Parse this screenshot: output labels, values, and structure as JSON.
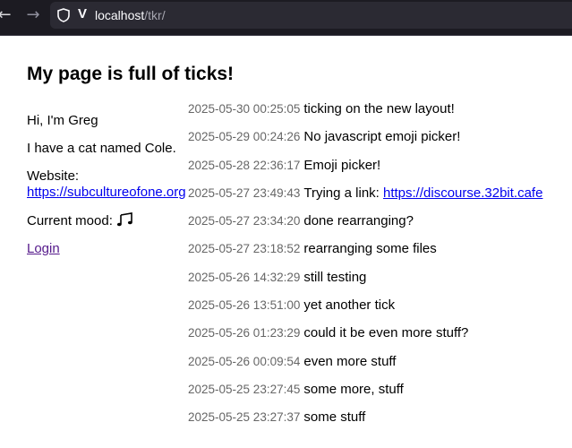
{
  "browser": {
    "url_host": "localhost",
    "url_path": "/tkr/",
    "back_icon": "arrow-left-icon",
    "forward_icon": "arrow-right-icon"
  },
  "page": {
    "title": "My page is full of ticks!"
  },
  "sidebar": {
    "greeting": "Hi, I'm Greg",
    "bio": "I have a cat named Cole.",
    "website_label": "Website:",
    "website_link": "https://subcultureofone.org",
    "mood_label": "Current mood: ",
    "mood_icon": "music-note-icon",
    "login_link": "Login"
  },
  "ticks": [
    {
      "timestamp": "2025-05-30 00:25:05",
      "text": "ticking on the new layout!"
    },
    {
      "timestamp": "2025-05-29 00:24:26",
      "text": "No javascript emoji picker!"
    },
    {
      "timestamp": "2025-05-28 22:36:17",
      "text": "Emoji picker!"
    },
    {
      "timestamp": "2025-05-27 23:49:43",
      "text": "Trying a link: ",
      "link": "https://discourse.32bit.cafe"
    },
    {
      "timestamp": "2025-05-27 23:34:20",
      "text": "done rearranging?"
    },
    {
      "timestamp": "2025-05-27 23:18:52",
      "text": "rearranging some files"
    },
    {
      "timestamp": "2025-05-26 14:32:29",
      "text": "still testing"
    },
    {
      "timestamp": "2025-05-26 13:51:00",
      "text": "yet another tick"
    },
    {
      "timestamp": "2025-05-26 01:23:29",
      "text": "could it be even more stuff?"
    },
    {
      "timestamp": "2025-05-26 00:09:54",
      "text": "even more stuff"
    },
    {
      "timestamp": "2025-05-25 23:27:45",
      "text": "some more, stuff"
    },
    {
      "timestamp": "2025-05-25 23:27:37",
      "text": "some stuff"
    }
  ]
}
